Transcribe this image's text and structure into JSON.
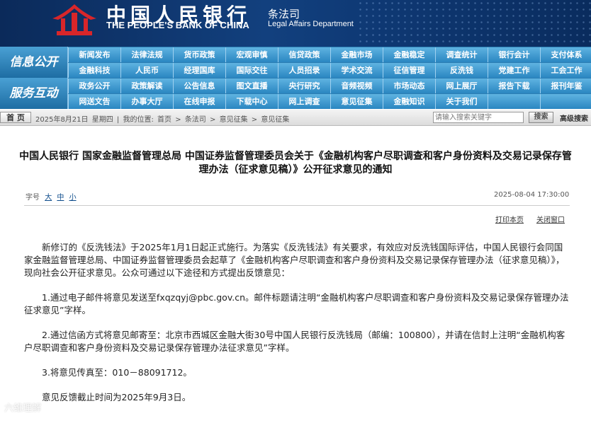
{
  "banner": {
    "bank_name_cn": "中国人民银行",
    "bank_name_en": "THE PEOPLE'S BANK OF CHINA",
    "dept_cn": "条法司",
    "dept_en": "Legal Affairs Department",
    "logo_icon": "pboc-emblem-icon"
  },
  "nav": {
    "section1_title": "信息公开",
    "section2_title": "服务互动",
    "rows": [
      [
        "新闻发布",
        "法律法规",
        "货币政策",
        "宏观审慎",
        "信贷政策",
        "金融市场",
        "金融稳定",
        "调查统计",
        "银行会计",
        "支付体系"
      ],
      [
        "金融科技",
        "人民币",
        "经理国库",
        "国际交往",
        "人员招录",
        "学术交流",
        "征信管理",
        "反洗钱",
        "党建工作",
        "工会工作"
      ],
      [
        "政务公开",
        "政策解读",
        "公告信息",
        "图文直播",
        "央行研究",
        "音频视频",
        "市场动态",
        "网上展厅",
        "报告下载",
        "报刊年鉴"
      ],
      [
        "网送文告",
        "办事大厅",
        "在线申报",
        "下载中心",
        "网上调查",
        "意见征集",
        "金融知识",
        "关于我们",
        "",
        ""
      ]
    ]
  },
  "crumb": {
    "home": "首 页",
    "date": "2025年8月21日",
    "weekday": "星期四",
    "sep": "|",
    "location_label": "我的位置:",
    "items": [
      "首页",
      "条法司",
      "意见征集",
      "意见征集"
    ],
    "arrow": ">",
    "search_placeholder": "请输入搜索关键字",
    "search_button": "搜索",
    "advanced_search": "高级搜索"
  },
  "article": {
    "title_line1": "中国人民银行 国家金融监督管理总局 中国证券监督管理委员会关于《金融机构客户尽职调查和客户身份资料及交易记录保存管",
    "title_line2": "理办法（征求意见稿）》公开征求意见的通知",
    "fontsize_label": "字号",
    "fontsize_large": "大",
    "fontsize_medium": "中",
    "fontsize_small": "小",
    "datetime": "2025-08-04 17:30:00",
    "print": "打印本页",
    "close": "关闭窗口",
    "paragraphs": [
      "新修订的《反洗钱法》于2025年1月1日起正式施行。为落实《反洗钱法》有关要求，有效应对反洗钱国际评估，中国人民银行会同国家金融监督管理总局、中国证券监督管理委员会起草了《金融机构客户尽职调查和客户身份资料及交易记录保存管理办法（征求意见稿）》，现向社会公开征求意见。公众可通过以下途径和方式提出反馈意见：",
      "1.通过电子邮件将意见发送至fxqzqyj@pbc.gov.cn。邮件标题请注明“金融机构客户尽职调查和客户身份资料及交易记录保存管理办法征求意见”字样。",
      "2.通过信函方式将意见邮寄至：北京市西城区金融大街30号中国人民银行反洗钱局（邮编：100800），并请在信封上注明“金融机构客户尽职调查和客户身份资料及交易记录保存管理办法征求意见”字样。",
      "3.将意见传真至：010－88091712。",
      "意见反馈截止时间为2025年9月3日。"
    ]
  },
  "watermark": "六维理解",
  "colors": {
    "banner": "#12407e",
    "nav": "#2c7fb4",
    "link": "#0b4a8a"
  }
}
